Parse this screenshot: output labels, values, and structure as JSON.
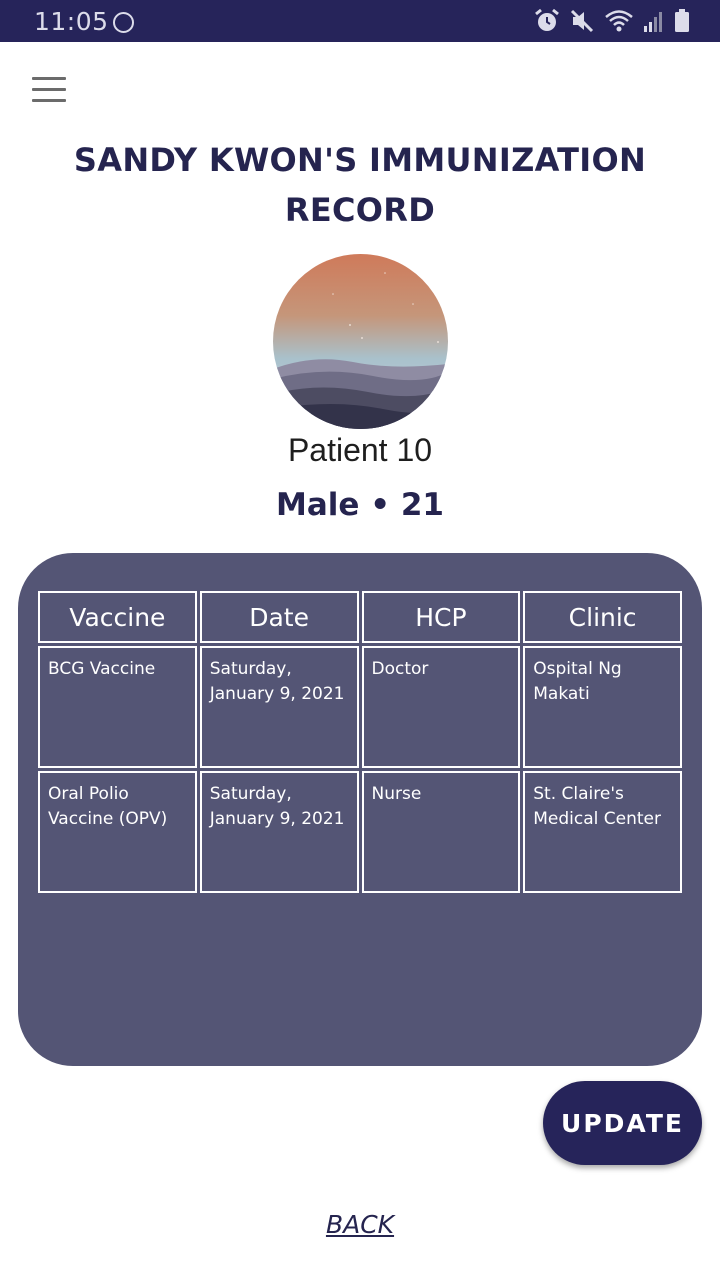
{
  "status_bar": {
    "time": "11:05",
    "icons": [
      "circle-icon",
      "alarm-icon",
      "mute-icon",
      "wifi-icon",
      "signal-icon",
      "battery-icon"
    ]
  },
  "header": {
    "menu_icon": "hamburger-menu-icon",
    "title": "SANDY KWON'S IMMUNIZATION RECORD"
  },
  "patient": {
    "name": "Patient 10",
    "meta": "Male • 21"
  },
  "table": {
    "headers": [
      "Vaccine",
      "Date",
      "HCP",
      "Clinic"
    ],
    "rows": [
      [
        "BCG Vaccine",
        "Saturday, January 9, 2021",
        "Doctor",
        "Ospital Ng Makati"
      ],
      [
        "Oral Polio Vaccine (OPV)",
        "Saturday, January 9, 2021",
        "Nurse",
        "St. Claire's Medical Center"
      ]
    ]
  },
  "actions": {
    "update_label": "UPDATE",
    "back_label": "BACK"
  },
  "colors": {
    "brand_navy": "#26245a",
    "card_bg": "#545575",
    "text_dark": "#25244f"
  }
}
